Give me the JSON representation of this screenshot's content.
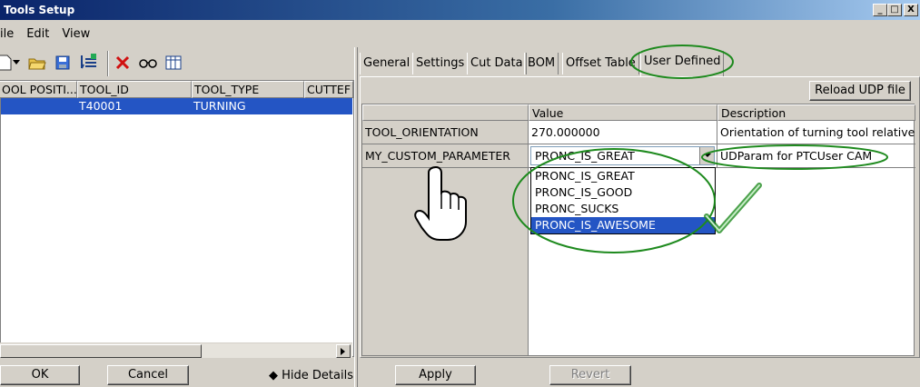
{
  "window": {
    "title": "Tools Setup",
    "controls": [
      "_",
      "□",
      "X"
    ]
  },
  "menu": [
    "ile",
    "Edit",
    "View"
  ],
  "toolbar": {
    "icons": [
      "new-file-icon",
      "dropdown-arrow-icon",
      "open-folder-icon",
      "save-icon",
      "tool-list-icon",
      "delete-icon",
      "glasses-icon",
      "table-view-icon"
    ]
  },
  "tool_table": {
    "columns": [
      "OOL POSITI...",
      "TOOL_ID",
      "TOOL_TYPE",
      "CUTTEF"
    ],
    "rows": [
      {
        "position": "",
        "tool_id": "T40001",
        "tool_type": "TURNING",
        "cutter": ""
      }
    ]
  },
  "tabs": [
    "General",
    "Settings",
    "Cut Data",
    "BOM",
    "Offset Table",
    "User Defined"
  ],
  "active_tab": "User Defined",
  "reload_button": "Reload UDP file",
  "udp_table": {
    "columns": [
      "",
      "Value",
      "Description"
    ],
    "rows": [
      {
        "name": "TOOL_ORIENTATION",
        "value": "270.000000",
        "description": "Orientation of turning tool relative to r"
      },
      {
        "name": "MY_CUSTOM_PARAMETER",
        "value": "PRONC_IS_GREAT",
        "description": "UDParam for PTCUser CAM"
      }
    ]
  },
  "dropdown_options": [
    "PRONC_IS_GREAT",
    "PRONC_IS_GOOD",
    "PRONC_SUCKS",
    "PRONC_IS_AWESOME"
  ],
  "dropdown_selected": "PRONC_IS_AWESOME",
  "bottom": {
    "ok": "OK",
    "cancel": "Cancel",
    "hide_details": "Hide Details",
    "apply": "Apply",
    "revert": "Revert"
  },
  "colors": {
    "selection": "#2455c4",
    "annotation": "#1e8a1e"
  }
}
